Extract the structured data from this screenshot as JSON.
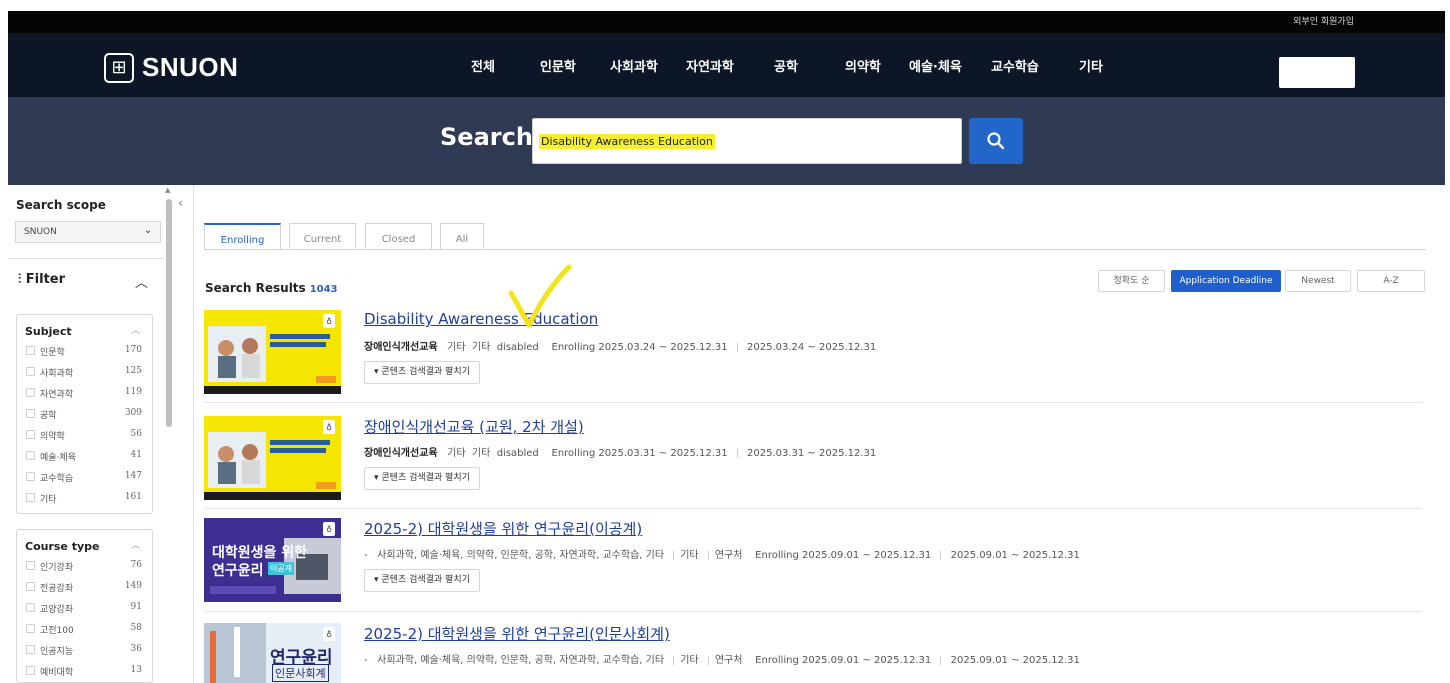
{
  "header": {
    "top_link": "외부인 회원가입",
    "logo_text": "SNUON",
    "logo_mark": "⊞",
    "nav": [
      "전체",
      "인문학",
      "사회과학",
      "자연과학",
      "공학",
      "의약학",
      "예술·체육",
      "교수학습",
      "기타"
    ]
  },
  "search": {
    "label": "Search",
    "value": "Disability Awareness Education",
    "button_icon": "search-icon"
  },
  "sidebar": {
    "scope_title": "Search scope",
    "scope_value": "SNUON",
    "filter_title": "Filter",
    "facets": [
      {
        "title": "Subject",
        "items": [
          {
            "name": "인문학",
            "count": "170"
          },
          {
            "name": "사회과학",
            "count": "125"
          },
          {
            "name": "자연과학",
            "count": "119"
          },
          {
            "name": "공학",
            "count": "309"
          },
          {
            "name": "의약학",
            "count": "56"
          },
          {
            "name": "예술·체육",
            "count": "41"
          },
          {
            "name": "교수학습",
            "count": "147"
          },
          {
            "name": "기타",
            "count": "161"
          }
        ]
      },
      {
        "title": "Course type",
        "items": [
          {
            "name": "인기강좌",
            "count": "76"
          },
          {
            "name": "전공강좌",
            "count": "149"
          },
          {
            "name": "교양강좌",
            "count": "91"
          },
          {
            "name": "고전100",
            "count": "58"
          },
          {
            "name": "인공지능",
            "count": "36"
          },
          {
            "name": "예비대학",
            "count": "13"
          }
        ]
      }
    ]
  },
  "tabs": [
    "Enrolling",
    "Current",
    "Closed",
    "All"
  ],
  "results_header": {
    "label": "Search Results",
    "count": "1043"
  },
  "sort": [
    "정확도 순",
    "Application Deadline",
    "Newest",
    "A-Z"
  ],
  "expand_label": "▾ 콘텐츠 검색결과 펼치기",
  "results": [
    {
      "title": "Disability Awareness Education",
      "org": "장애인식개선교육",
      "meta": [
        "기타",
        "기타",
        "disabled",
        "Enrolling 2025.03.24 ~ 2025.12.31",
        "2025.03.24 ~ 2025.12.31"
      ]
    },
    {
      "title": "장애인식개선교육 (교원, 2차 개설)",
      "org": "장애인식개선교육",
      "meta": [
        "기타",
        "기타",
        "disabled",
        "Enrolling 2025.03.31 ~ 2025.12.31",
        "2025.03.31 ~ 2025.12.31"
      ]
    },
    {
      "title": "2025-2) 대학원생을 위한 연구윤리(이공계)",
      "org": "-",
      "meta": [
        "사회과학, 예술·체육, 의약학, 인문학, 공학, 자연과학, 교수학습, 기타",
        "기타",
        "연구처",
        "Enrolling 2025.09.01 ~ 2025.12.31",
        "2025.09.01 ~ 2025.12.31"
      ]
    },
    {
      "title": "2025-2) 대학원생을 위한 연구윤리(인문사회계)",
      "org": "-",
      "meta": [
        "사회과학, 예술·체육, 의약학, 인문학, 공학, 자연과학, 교수학습, 기타",
        "기타",
        "연구처",
        "Enrolling 2025.09.01 ~ 2025.12.31",
        "2025.09.01 ~ 2025.12.31"
      ]
    }
  ],
  "thumbs": [
    {
      "line1": "그리도 볼수 일건 없으면",
      "line2": "함께 하는 장애인식개선교육"
    },
    {
      "line1": "그리도 볼수 일건 없으면",
      "line2": "함께 하는 장애인식개선교육"
    },
    {
      "line1": "대학원생을 위한",
      "line2": "연구윤리",
      "tag": "이공계"
    },
    {
      "line1": "연구윤리",
      "line2": "인문사회계"
    }
  ],
  "colors": {
    "accent": "#2a61c3",
    "nav_bg": "#0d1627",
    "search_band": "#2f3a54",
    "highlight": "#f6ef2d"
  }
}
